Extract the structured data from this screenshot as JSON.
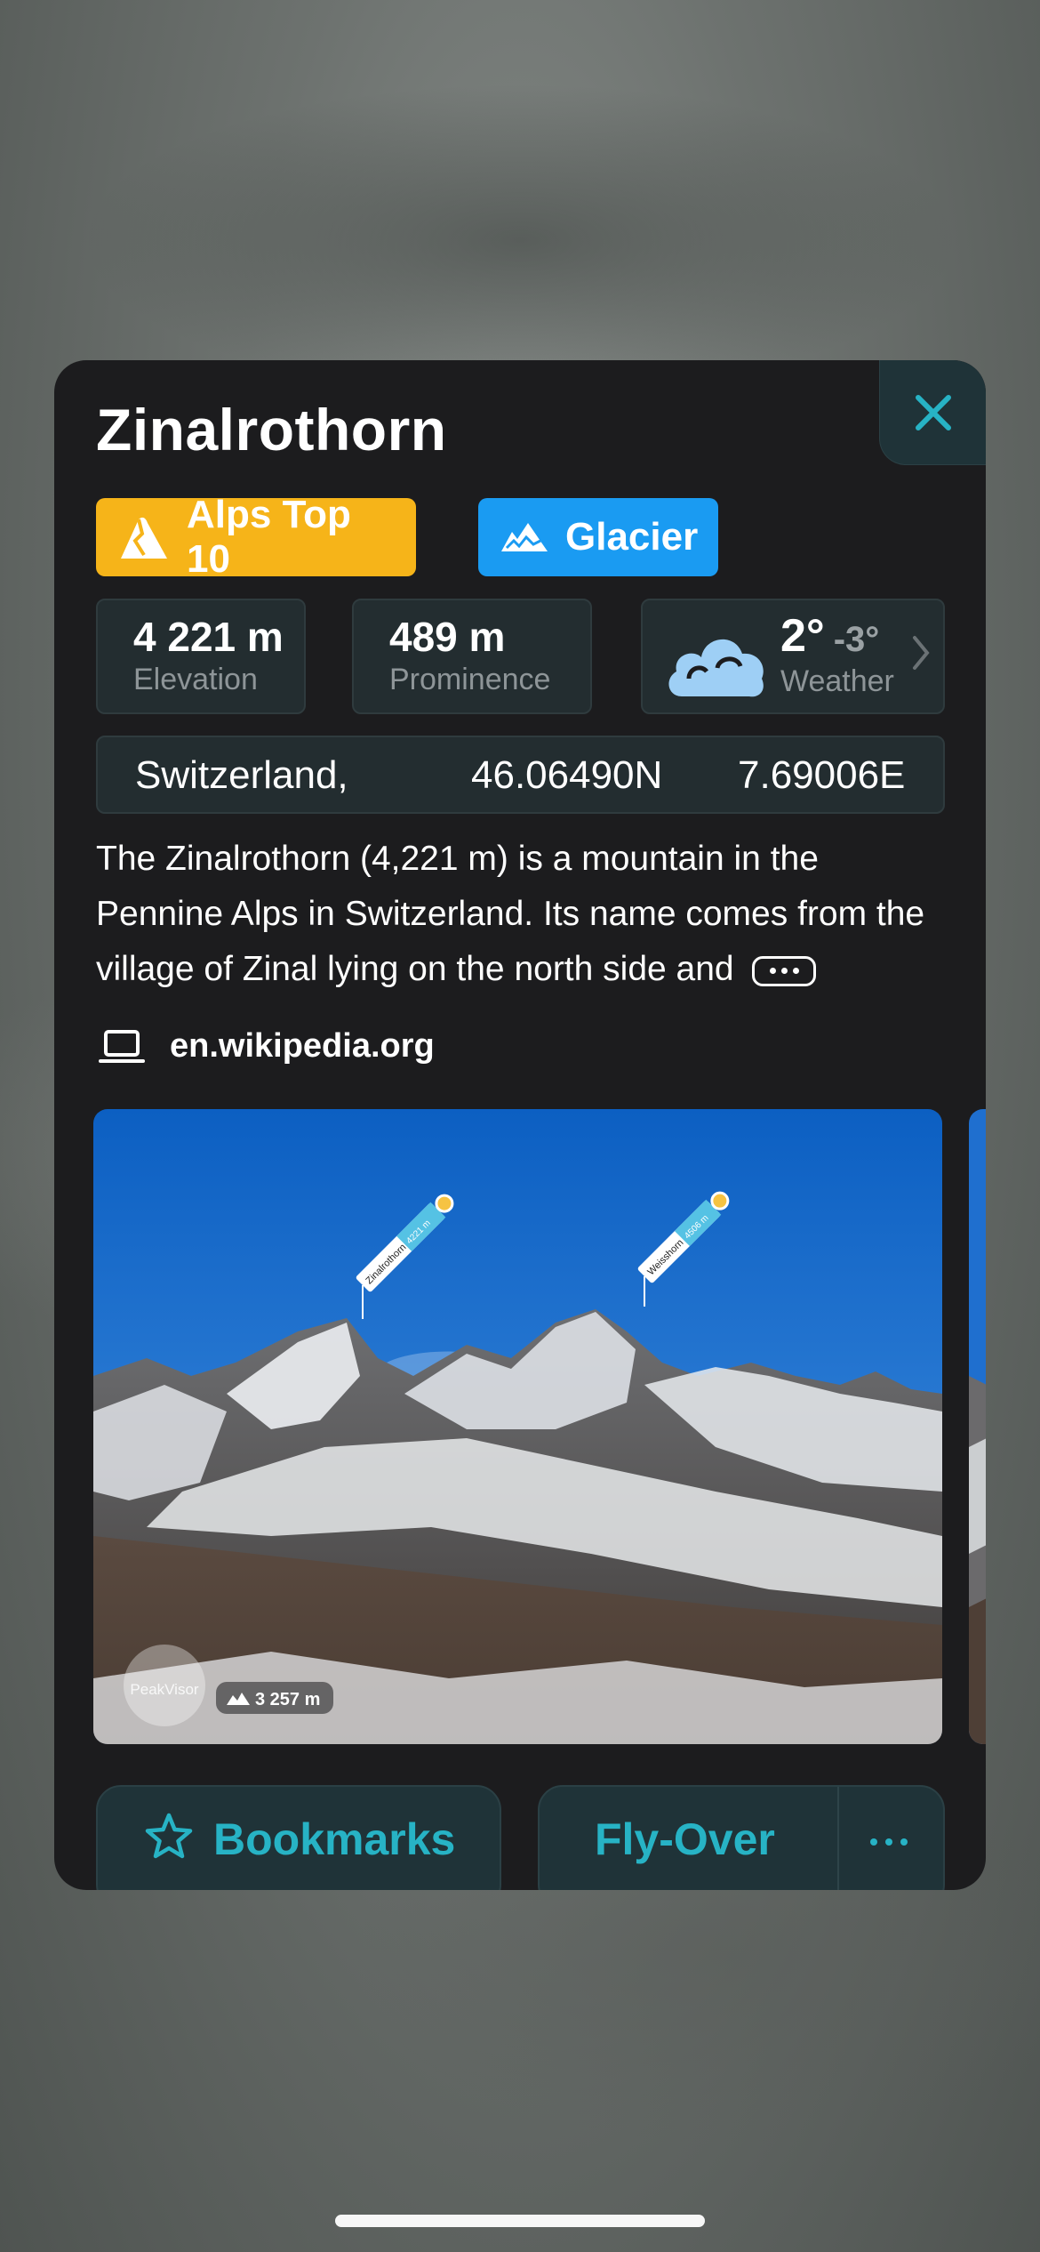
{
  "peak": {
    "name": "Zinalrothorn",
    "tags": [
      {
        "label": "Alps Top 10",
        "color": "#f6b419",
        "icon": "mountain-peak-icon"
      },
      {
        "label": "Glacier",
        "color": "#1a9bf2",
        "icon": "glacier-icon"
      }
    ]
  },
  "stats": {
    "elevation": {
      "value": "4 221 m",
      "label": "Elevation"
    },
    "prominence": {
      "value": "489 m",
      "label": "Prominence"
    },
    "weather": {
      "high": "2°",
      "low": "-3°",
      "label": "Weather",
      "icon": "cloud-icon"
    }
  },
  "location": {
    "country": "Switzerland,",
    "lat": "46.06490N",
    "lon": "7.69006E"
  },
  "description": {
    "text": "The Zinalrothorn (4,221 m) is a mountain in the Pennine Alps in Switzerland. Its name comes from the village of Zinal lying on the north side and",
    "source": "en.wikipedia.org"
  },
  "photo": {
    "labels": [
      {
        "name": "Zinalrothorn",
        "elev": "4221 m"
      },
      {
        "name": "Weisshorn",
        "elev": "4506 m"
      }
    ],
    "watermark": "PeakVisor",
    "viewpoint_elev": "3 257 m"
  },
  "actions": {
    "bookmarks": "Bookmarks",
    "flyover": "Fly-Over"
  },
  "colors": {
    "accent": "#27b3c5",
    "card_bg": "#1c1c1e",
    "panel_bg": "#232d30"
  }
}
